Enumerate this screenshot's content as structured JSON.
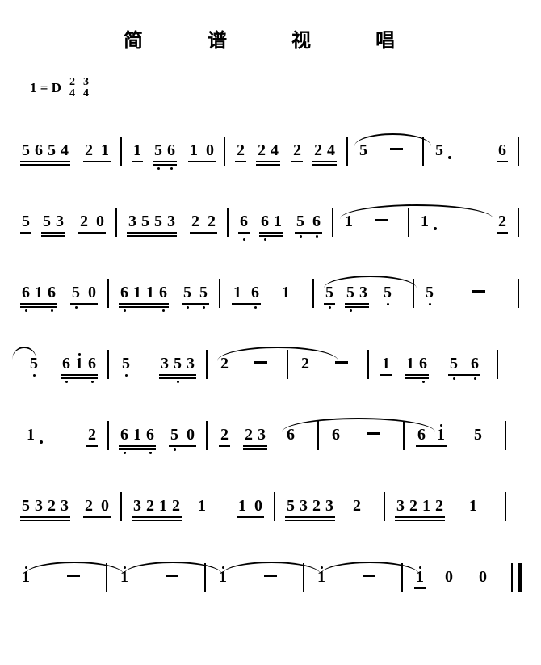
{
  "title": "简　谱　视　唱",
  "key": {
    "one_eq": "1 = D",
    "ts1_top": "2",
    "ts1_bot": "4",
    "ts2_top": "3",
    "ts2_bot": "4"
  },
  "notes": {
    "l1": [
      "5",
      "6",
      "5",
      "4",
      "2",
      "1",
      "1",
      "5",
      "6",
      "1",
      "0",
      "2",
      "2",
      "4",
      "2",
      "2",
      "4",
      "5",
      "5",
      ".",
      "6"
    ],
    "l2": [
      "5",
      "5",
      "3",
      "2",
      "0",
      "3",
      "5",
      "5",
      "3",
      "2",
      "2",
      "6",
      "6",
      "1",
      "5",
      "6",
      "1",
      "1",
      ".",
      "2"
    ],
    "l3": [
      "6",
      "1",
      "6",
      "5",
      "0",
      "6",
      "1",
      "1",
      "6",
      "5",
      "5",
      "1",
      "6",
      "1",
      "5",
      "5",
      "3",
      "5",
      "5"
    ],
    "l4": [
      "5",
      "6",
      "1",
      "6",
      "5",
      "3",
      "5",
      "3",
      "2",
      "2",
      "1",
      "1",
      "6",
      "5",
      "6"
    ],
    "l5": [
      "1",
      ".",
      "2",
      "6",
      "1",
      "6",
      "5",
      "0",
      "2",
      "2",
      "3",
      "6",
      "6",
      "6",
      "1",
      "5"
    ],
    "l6": [
      "5",
      "3",
      "2",
      "3",
      "2",
      "0",
      "3",
      "2",
      "1",
      "2",
      "1",
      "1",
      "0",
      "5",
      "3",
      "2",
      "3",
      "2",
      "3",
      "2",
      "1",
      "2",
      "1"
    ],
    "l7": [
      "1",
      "1",
      "1",
      "1",
      "1",
      "0",
      "0"
    ]
  },
  "chart_data": null
}
